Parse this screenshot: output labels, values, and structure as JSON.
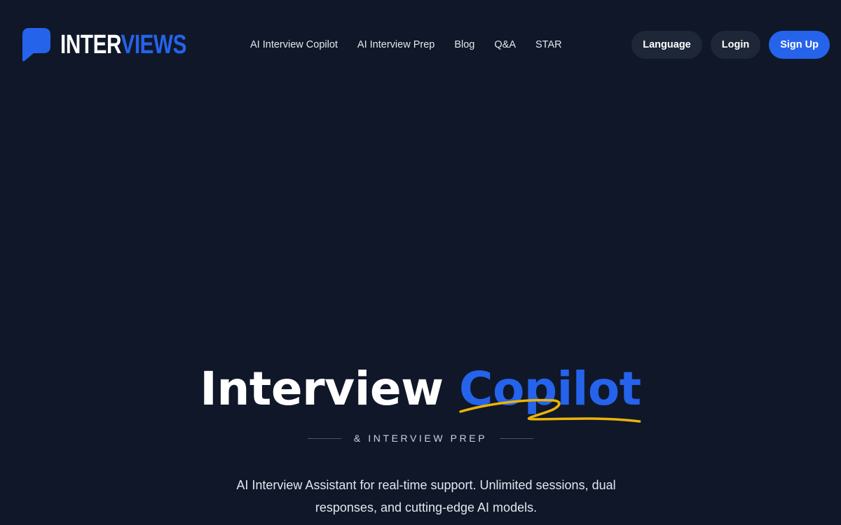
{
  "header": {
    "logo": {
      "part_a": "INTER",
      "part_b": "VIEWS",
      "icon": "speech-bubble-icon",
      "accent_color": "#2563eb"
    },
    "nav": [
      {
        "label": "AI Interview Copilot"
      },
      {
        "label": "AI Interview Prep"
      },
      {
        "label": "Blog"
      },
      {
        "label": "Q&A"
      },
      {
        "label": "STAR"
      }
    ],
    "actions": {
      "language": "Language",
      "login": "Login",
      "signup": "Sign Up"
    }
  },
  "hero": {
    "title_part1": "Interview",
    "title_part2": "Copilot",
    "subtitle": "& INTERVIEW PREP",
    "description": "AI Interview Assistant for real-time support. Unlimited sessions, dual responses, and cutting-edge AI models."
  },
  "colors": {
    "background": "#0f1729",
    "accent": "#2563eb",
    "underline": "#eab308",
    "button_dark": "#1e2737"
  }
}
